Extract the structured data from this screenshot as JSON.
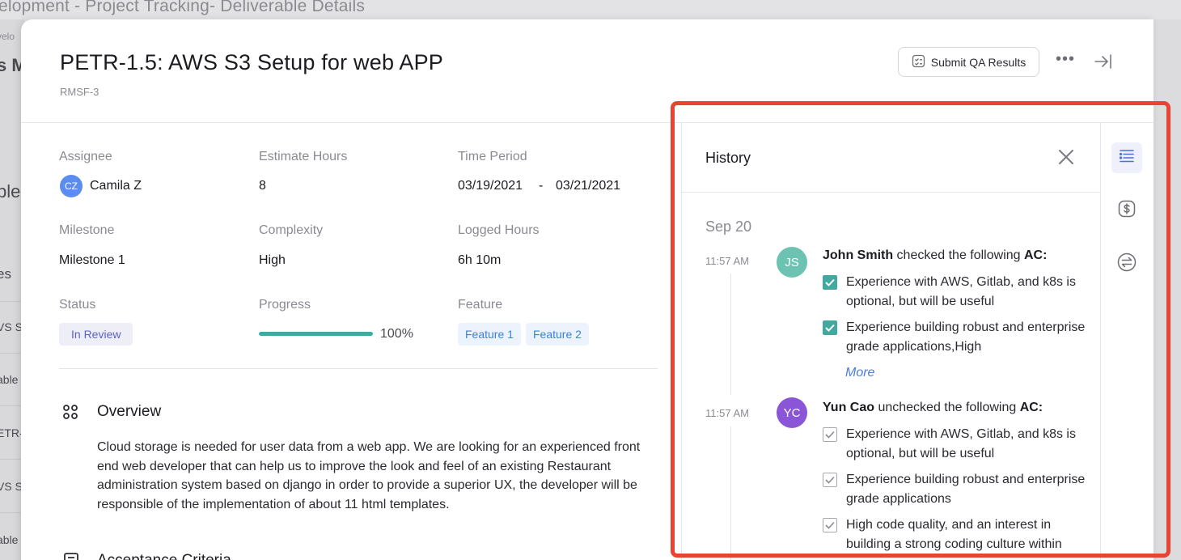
{
  "background": {
    "title": "elopment - Project Tracking- Deliverable Details",
    "left_fragments": [
      "velo",
      "s M",
      "ble",
      "es",
      "VS S",
      "able",
      "ETR-",
      "VS S",
      "able"
    ]
  },
  "header": {
    "title": "PETR-1.5:  AWS S3 Setup for web APP",
    "subtitle": "RMSF-3",
    "submit_label": "Submit QA Results",
    "more_label": "•••"
  },
  "details": {
    "assignee_label": "Assignee",
    "assignee_initials": "CZ",
    "assignee_name": "Camila Z",
    "estimate_label": "Estimate Hours",
    "estimate_value": "8",
    "period_label": "Time Period",
    "period_start": "03/19/2021",
    "period_sep": "-",
    "period_end": "03/21/2021",
    "milestone_label": "Milestone",
    "milestone_value": "Milestone 1",
    "complexity_label": "Complexity",
    "complexity_value": "High",
    "logged_label": "Logged Hours",
    "logged_value": "6h 10m",
    "status_label": "Status",
    "status_value": "In Review",
    "progress_label": "Progress",
    "progress_value": "100%",
    "progress_fraction": 1.0,
    "feature_label": "Feature",
    "features": [
      "Feature 1",
      "Feature 2"
    ]
  },
  "overview": {
    "title": "Overview",
    "text": "Cloud storage is needed for user data from a web app. We are looking for an experienced front end web developer that can help us to improve the look and feel of an existing Restaurant administration system based on django in order to provide a superior UX, the developer will be responsible of the implementation of about 11 html templates."
  },
  "acceptance": {
    "title": "Acceptance Criteria"
  },
  "history": {
    "title": "History",
    "date": "Sep 20",
    "entries": [
      {
        "time": "11:57 AM",
        "initials": "JS",
        "avatar_color": "#6cc3b1",
        "user": "John Smith",
        "action": " checked the following ",
        "target": "AC:",
        "items": [
          "Experience with AWS, Gitlab, and k8s is optional, but will be useful",
          "Experience building robust and enterprise grade applications,High"
        ],
        "more": "More"
      },
      {
        "time": "11:57 AM",
        "initials": "YC",
        "avatar_color": "#8a55d6",
        "user": "Yun Cao",
        "action": " unchecked the following ",
        "target": "AC:",
        "items": [
          "Experience with AWS, Gitlab, and k8s is optional, but will be useful",
          "Experience building robust and enterprise grade applications",
          "High code quality, and an interest in building a strong coding culture within"
        ]
      }
    ]
  },
  "rail": {
    "icons": [
      "list-icon",
      "dollar-icon",
      "transfer-icon"
    ]
  },
  "colors": {
    "accent_teal": "#42a9a1",
    "highlight_red": "#e94334",
    "link_blue": "#4a7de0"
  }
}
